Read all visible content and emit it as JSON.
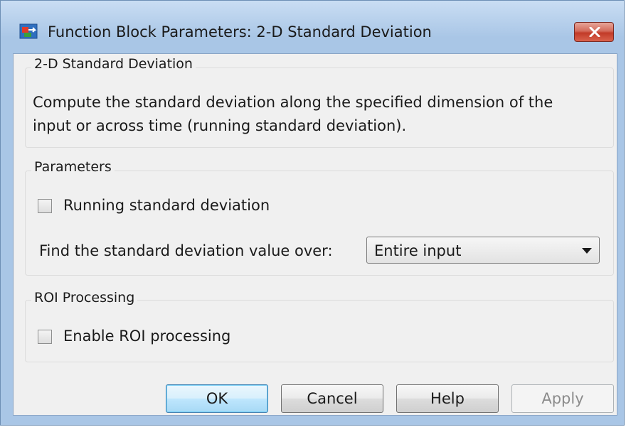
{
  "window": {
    "title": "Function Block Parameters: 2-D Standard Deviation",
    "app_icon": "simulink-block-icon",
    "close_icon": "close-icon"
  },
  "description_group": {
    "title": "2-D Standard Deviation",
    "text_line1": "Compute the standard deviation along the specified dimension of the",
    "text_line2": "input or across time (running standard deviation)."
  },
  "parameters_group": {
    "title": "Parameters",
    "running_checkbox": {
      "label": "Running standard deviation",
      "checked": false
    },
    "find_label": "Find the standard deviation value over:",
    "find_select": {
      "value": "Entire input"
    }
  },
  "roi_group": {
    "title": "ROI Processing",
    "roi_checkbox": {
      "label": "Enable ROI processing",
      "checked": false
    }
  },
  "buttons": {
    "ok": "OK",
    "cancel": "Cancel",
    "help": "Help",
    "apply": "Apply"
  },
  "colors": {
    "frame": "#a9c6e6",
    "close_button": "#c23b28",
    "client_bg": "#f0f0f0",
    "default_button_border": "#3c7fb1"
  }
}
